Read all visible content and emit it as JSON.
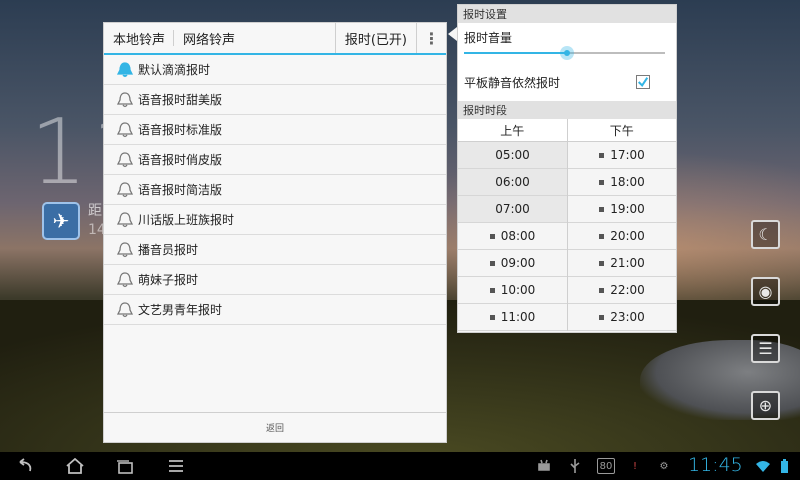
{
  "background": {
    "clock_partial": "11",
    "widget_line1": "距",
    "widget_line2": "14"
  },
  "ringtone_panel": {
    "tabs": [
      {
        "label": "本地铃声",
        "active": true
      },
      {
        "label": "网络铃声",
        "active": false
      }
    ],
    "hourly_toggle": "报时(已开)",
    "menu_icon": "overflow-menu-icon",
    "items": [
      {
        "label": "默认滴滴报时",
        "selected": true
      },
      {
        "label": "语音报时甜美版",
        "selected": false
      },
      {
        "label": "语音报时标准版",
        "selected": false
      },
      {
        "label": "语音报时俏皮版",
        "selected": false
      },
      {
        "label": "语音报时简洁版",
        "selected": false
      },
      {
        "label": "川话版上班族报时",
        "selected": false
      },
      {
        "label": "播音员报时",
        "selected": false
      },
      {
        "label": "萌妹子报时",
        "selected": false
      },
      {
        "label": "文艺男青年报时",
        "selected": false
      }
    ],
    "back_label": "返回"
  },
  "settings_panel": {
    "title": "报时设置",
    "volume_label": "报时音量",
    "volume_value": 0.51,
    "mute_label": "平板静音依然报时",
    "mute_checked": true,
    "period_title": "报时时段",
    "am_label": "上午",
    "pm_label": "下午",
    "am_slots": [
      {
        "time": "05:00",
        "enabled": false
      },
      {
        "time": "06:00",
        "enabled": false
      },
      {
        "time": "07:00",
        "enabled": false
      },
      {
        "time": "08:00",
        "enabled": true
      },
      {
        "time": "09:00",
        "enabled": true
      },
      {
        "time": "10:00",
        "enabled": true
      },
      {
        "time": "11:00",
        "enabled": true
      }
    ],
    "pm_slots": [
      {
        "time": "17:00",
        "enabled": true
      },
      {
        "time": "18:00",
        "enabled": true
      },
      {
        "time": "19:00",
        "enabled": true
      },
      {
        "time": "20:00",
        "enabled": true
      },
      {
        "time": "21:00",
        "enabled": true
      },
      {
        "time": "22:00",
        "enabled": true
      },
      {
        "time": "23:00",
        "enabled": true
      }
    ]
  },
  "side_icons": [
    "night-mode-icon",
    "alarm-device-icon",
    "list-icon",
    "add-widget-icon"
  ],
  "system_bar": {
    "nav": [
      "back-icon",
      "home-icon",
      "recent-apps-icon",
      "menu-icon"
    ],
    "status_icons": [
      "android-debug-icon",
      "usb-icon",
      "battery-level-icon",
      "notification-icon",
      "alert-icon"
    ],
    "battery_badge": "80",
    "time": "11:45"
  },
  "colors": {
    "accent": "#33b5e5",
    "panel": "#f7f7f7"
  }
}
